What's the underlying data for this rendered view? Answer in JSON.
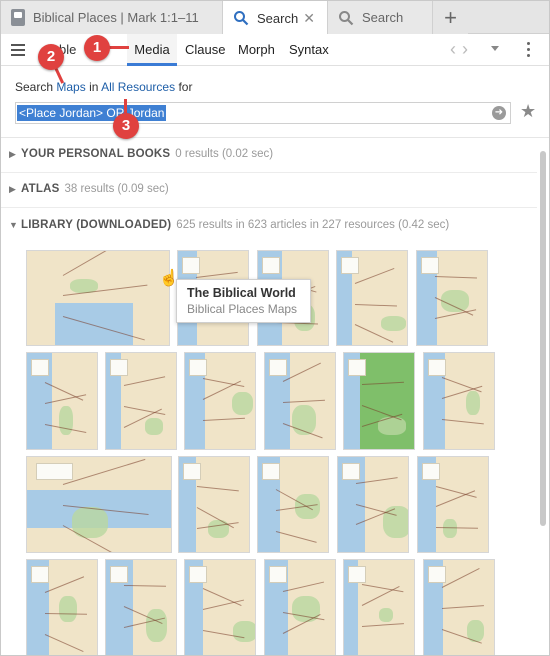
{
  "tabs": [
    {
      "label": "Biblical Places | Mark 1:1–11",
      "icon": "book-icon"
    },
    {
      "label": "Search",
      "icon": "search-icon",
      "active": true
    },
    {
      "label": "Search",
      "icon": "search-icon"
    },
    {
      "label": "+",
      "icon": "plus-icon"
    }
  ],
  "toolbar": {
    "modes": [
      "ble",
      "Media",
      "Clause",
      "Morph",
      "Syntax"
    ],
    "active_mode": "Media"
  },
  "search": {
    "prefix": "Search",
    "type_link": "Maps",
    "in_word": "in",
    "scope_link": "All Resources",
    "for_word": "for",
    "query": "<Place Jordan> OR Jordan"
  },
  "sections": [
    {
      "name": "YOUR PERSONAL BOOKS",
      "info": "0 results (0.02 sec)",
      "expanded": false
    },
    {
      "name": "ATLAS",
      "info": "38 results (0.09 sec)",
      "expanded": false
    },
    {
      "name": "LIBRARY (DOWNLOADED)",
      "info": "625 results in 623 articles in 227 resources (0.42 sec)",
      "expanded": true
    }
  ],
  "tooltip": {
    "title": "The Biblical World",
    "subtitle": "Biblical Places Maps"
  },
  "callouts": [
    "1",
    "2",
    "3"
  ],
  "colors": {
    "accent": "#3a7bd5",
    "link": "#1f5fa8",
    "callout": "#e0413f",
    "selection": "#3f80d3"
  }
}
